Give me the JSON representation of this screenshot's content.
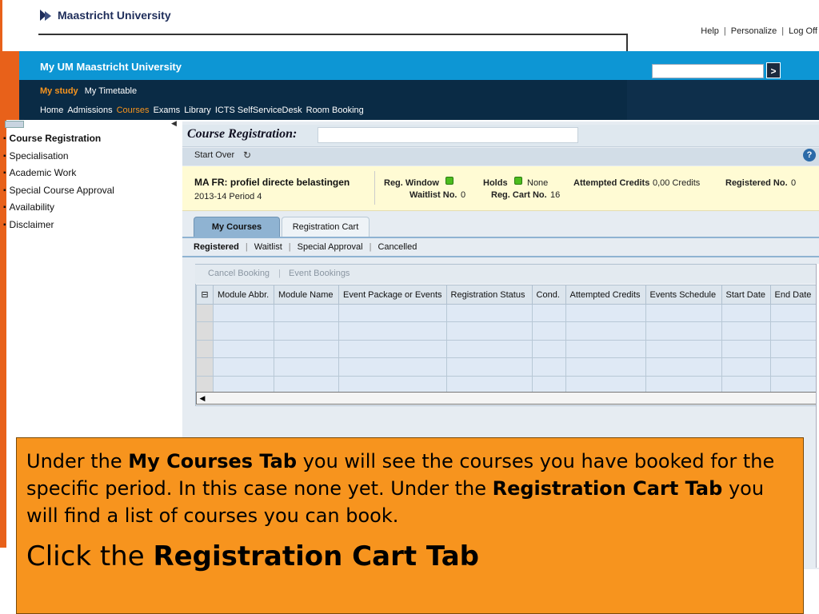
{
  "brand": {
    "name": "Maastricht University"
  },
  "toplinks": [
    "Help",
    "Personalize",
    "Log Off"
  ],
  "portal": {
    "title": "My UM Maastricht University",
    "search_value": "",
    "go_label": ">"
  },
  "nav_primary": [
    {
      "label": "My study",
      "active": true
    },
    {
      "label": "My Timetable",
      "active": false
    }
  ],
  "nav_secondary": [
    {
      "label": "Home",
      "active": false
    },
    {
      "label": "Admissions",
      "active": false
    },
    {
      "label": "Courses",
      "active": true
    },
    {
      "label": "Exams",
      "active": false
    },
    {
      "label": "Library",
      "active": false
    },
    {
      "label": "ICTS SelfServiceDesk",
      "active": false
    },
    {
      "label": "Room Booking",
      "active": false
    }
  ],
  "sidebar": {
    "items": [
      {
        "label": "Course Registration",
        "selected": true
      },
      {
        "label": "Specialisation",
        "selected": false
      },
      {
        "label": "Academic Work",
        "selected": false
      },
      {
        "label": "Special Course Approval",
        "selected": false
      },
      {
        "label": "Availability",
        "selected": false
      },
      {
        "label": "Disclaimer",
        "selected": false
      }
    ]
  },
  "main": {
    "title": "Course Registration:",
    "title_field": "",
    "toolbar": {
      "start_over": "Start Over"
    },
    "program": {
      "name": "MA FR: profiel directe belastingen",
      "period": "2013-14 Period 4"
    },
    "status": {
      "reg_window_label": "Reg. Window",
      "waitlist_label": "Waitlist No.",
      "waitlist_value": "0",
      "holds_label": "Holds",
      "holds_value": "None",
      "reg_cart_label": "Reg. Cart No.",
      "reg_cart_value": "16",
      "attempted_credits_label": "Attempted Credits",
      "attempted_credits_value": "0,00 Credits",
      "registered_label": "Registered No.",
      "registered_value": "0",
      "led_color": "#4cbc1e"
    },
    "tabs": [
      {
        "label": "My Courses",
        "active": true
      },
      {
        "label": "Registration Cart",
        "active": false
      }
    ],
    "subtabs": [
      {
        "label": "Registered",
        "active": true
      },
      {
        "label": "Waitlist",
        "active": false
      },
      {
        "label": "Special Approval",
        "active": false
      },
      {
        "label": "Cancelled",
        "active": false
      }
    ],
    "table": {
      "actions": [
        "Cancel Booking",
        "Event Bookings"
      ],
      "columns": [
        "Module Abbr.",
        "Module Name",
        "Event Package or Events",
        "Registration Status",
        "Cond.",
        "Attempted Credits",
        "Events Schedule",
        "Start Date",
        "End Date"
      ],
      "empty_rows": 5
    }
  },
  "callout": {
    "p1_a": "Under the ",
    "p1_b": "My Courses Tab",
    "p1_c": " you will see the courses you have booked for the specific period. In this case none yet. Under the ",
    "p1_d": "Registration Cart Tab",
    "p1_e": " you will find a list of courses you can book.",
    "p2_a": "Click the ",
    "p2_b": "Registration Cart Tab"
  },
  "colors": {
    "accent_orange": "#f7941e",
    "brand_blue": "#0d96d4",
    "nav_dark": "#0a2b45",
    "nav_active": "#f7941e"
  }
}
